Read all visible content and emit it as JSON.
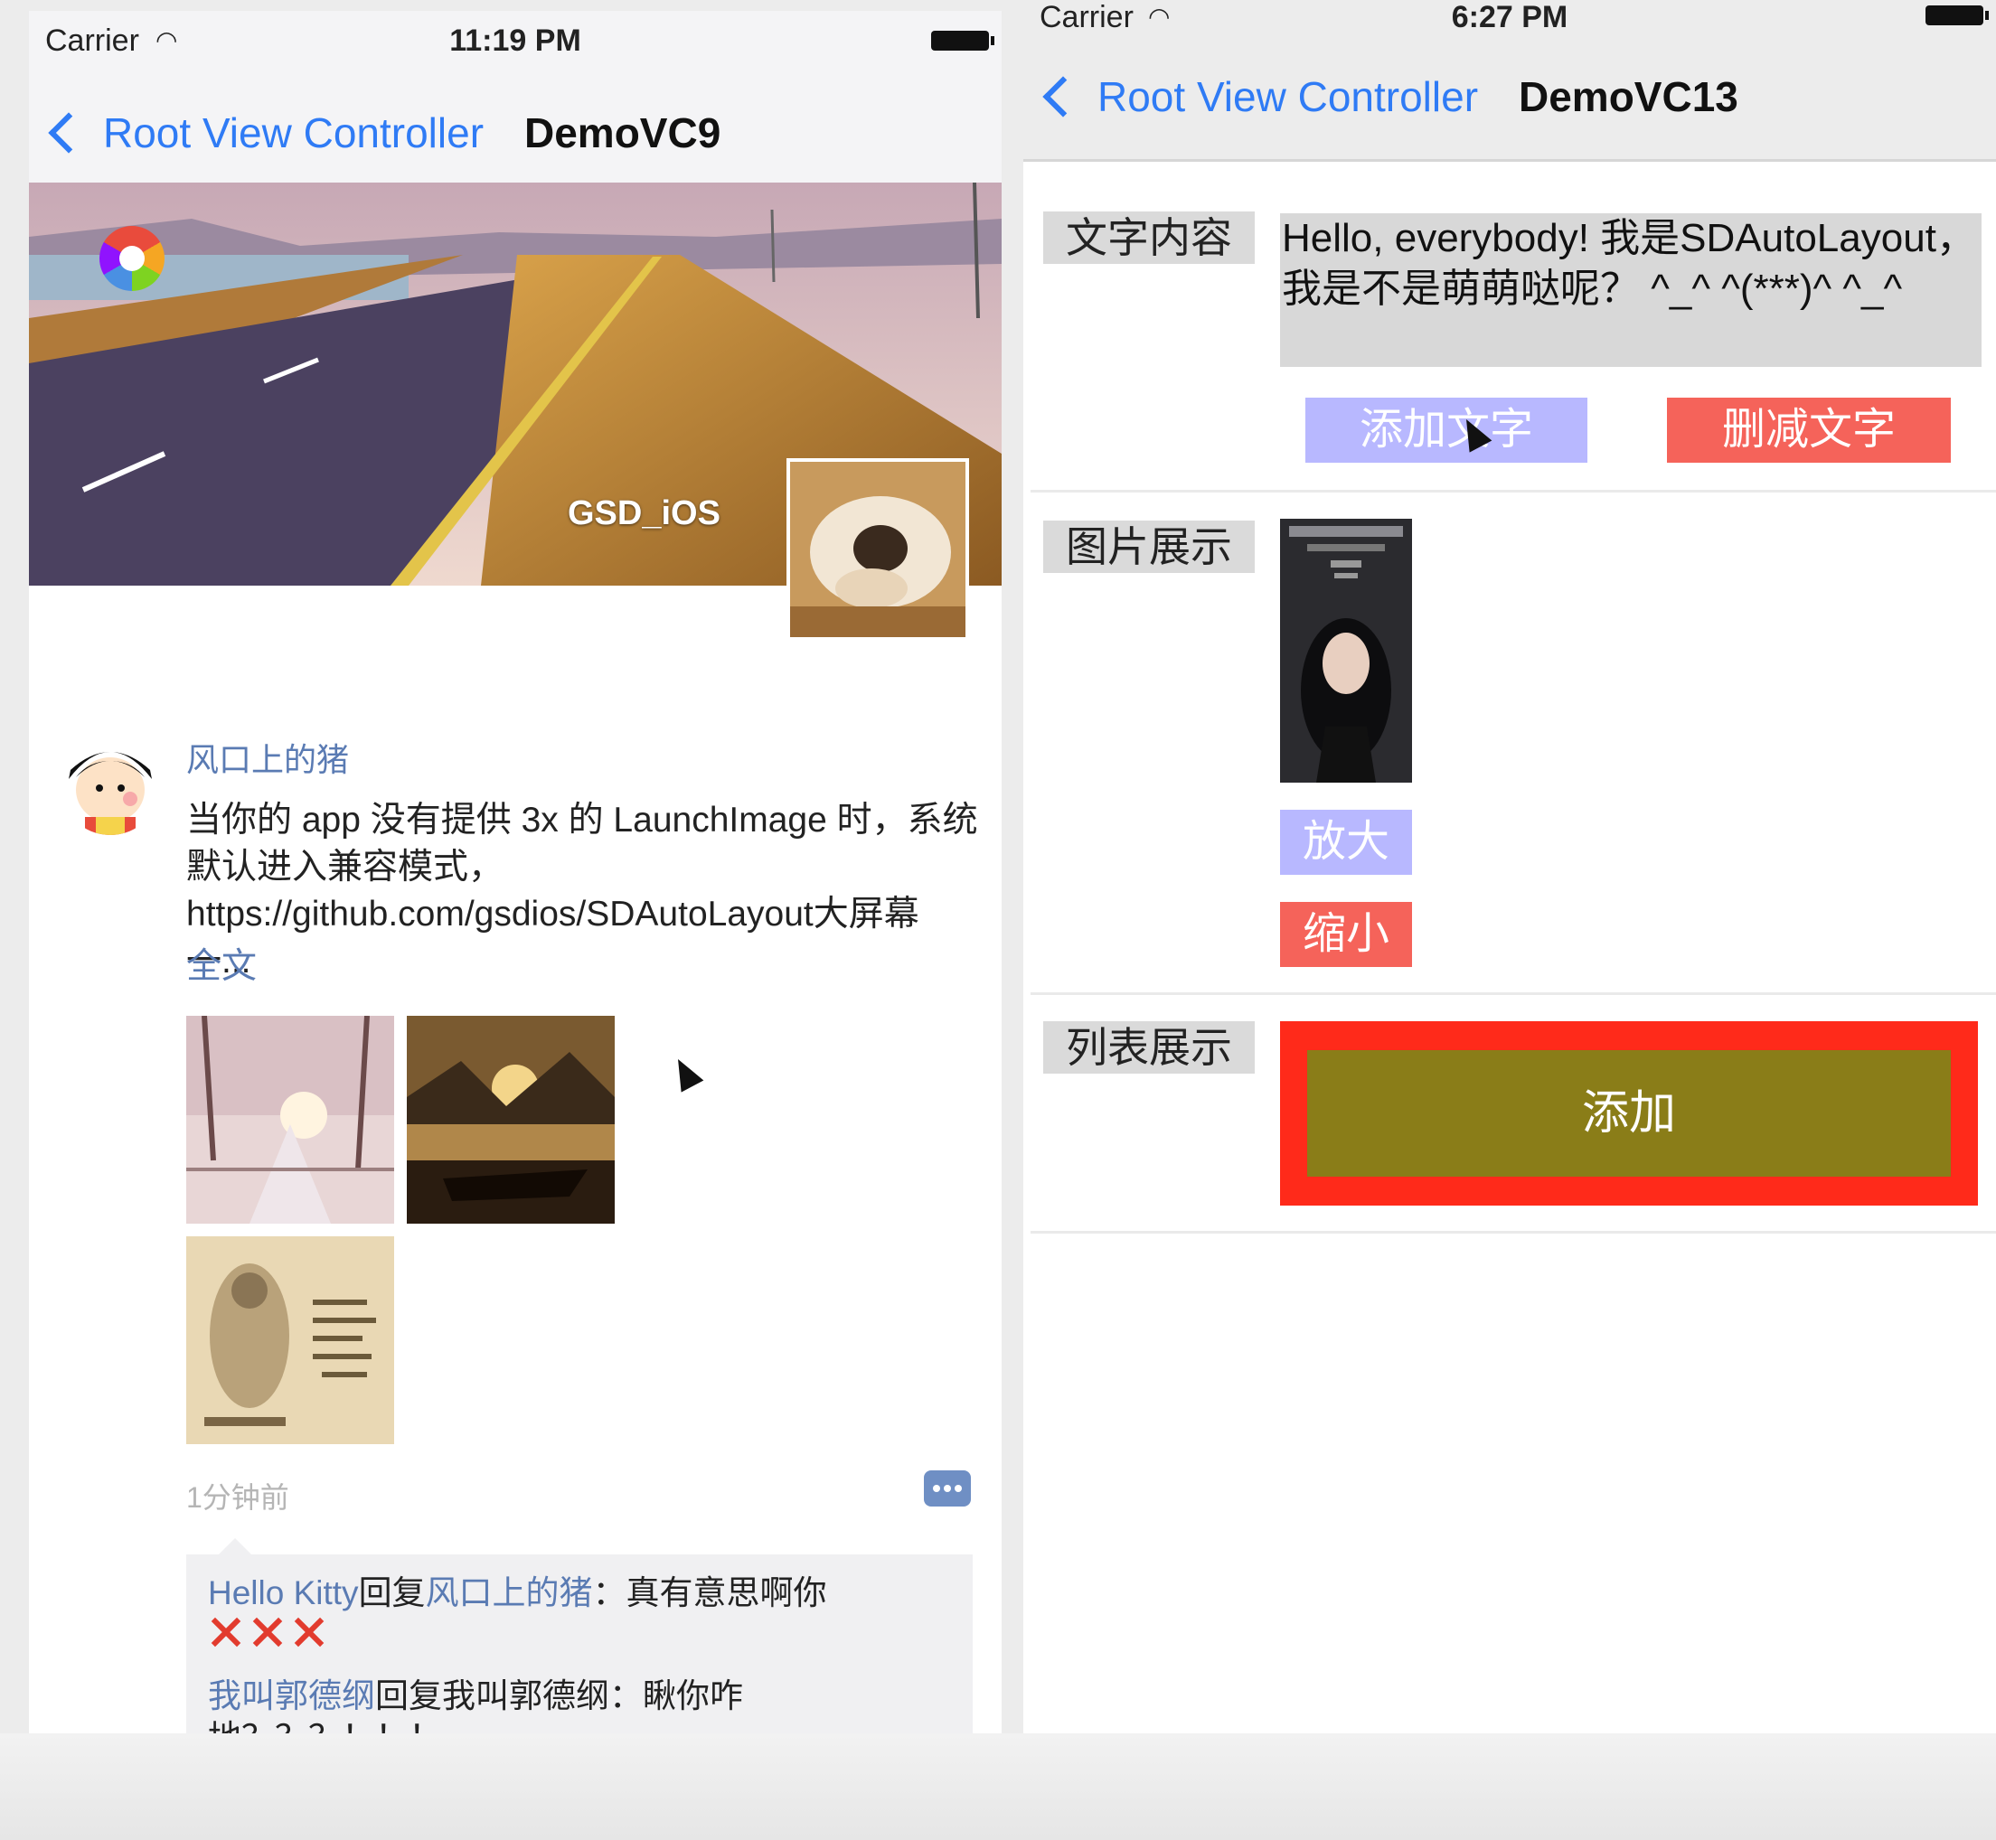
{
  "left": {
    "status": {
      "carrier": "Carrier",
      "time": "11:19 PM"
    },
    "nav": {
      "back_label": "Root View Controller",
      "title": "DemoVC9"
    },
    "banner": {
      "name": "GSD_iOS"
    },
    "post": {
      "user_name": "风口上的猪",
      "text": "当你的 app 没有提供 3x 的 LaunchImage 时，系统默认进入兼容模式，https://github.com/gsdios/SDAutoLayout大屏幕一...",
      "fulltext_label": "全文",
      "time": "1分钟前",
      "comments": [
        {
          "from": "Hello Kitty",
          "reply_word": "回复",
          "to": "风口上的猪",
          "text": "：真有意思啊你"
        },
        {
          "from": "我叫郭德纲",
          "reply_word": "回复",
          "to": "我叫郭德纲",
          "text": "：瞅你咋地？？？！！！"
        }
      ]
    }
  },
  "right": {
    "status": {
      "carrier": "Carrier",
      "time": "6:27 PM"
    },
    "nav": {
      "back_label": "Root View Controller",
      "title": "DemoVC13"
    },
    "sections": {
      "text_label": "文字内容",
      "text_content": "Hello, everybody! 我是SDAutoLayout，我是不是萌萌哒呢？ ^_^ ^(***)^ ^_^",
      "add_text_button": "添加文字",
      "remove_text_button": "删减文字",
      "image_label": "图片展示",
      "zoom_in_button": "放大",
      "zoom_out_button": "缩小",
      "list_label": "列表展示",
      "add_button": "添加"
    },
    "colors": {
      "lavender": "#b8b8ff",
      "coral": "#f5635a",
      "red": "#ff2a1a",
      "olive": "#8a7d18"
    }
  }
}
